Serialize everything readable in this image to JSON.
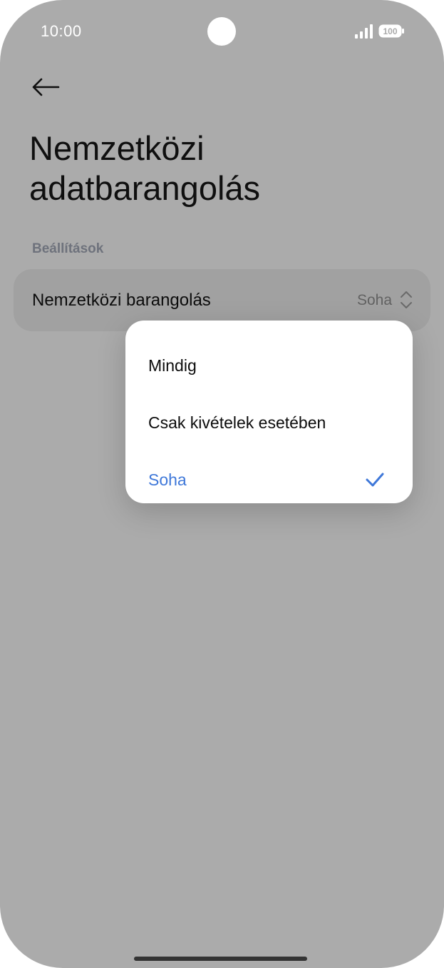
{
  "status_bar": {
    "time": "10:00",
    "battery_level": "100",
    "icons": [
      "signal-icon",
      "battery-icon"
    ]
  },
  "header": {
    "back_icon": "arrow-left-icon",
    "title_line1": "Nemzetközi",
    "title_line2": "adatbarangolás"
  },
  "section": {
    "label": "Beállítások"
  },
  "setting": {
    "label": "Nemzetközi barangolás",
    "value": "Soha",
    "icon": "chevron-up-down-icon"
  },
  "dropdown": {
    "options": [
      {
        "label": "Mindig",
        "selected": false
      },
      {
        "label": "Csak kivételek esetében",
        "selected": false
      },
      {
        "label": "Soha",
        "selected": true
      }
    ],
    "check_icon": "checkmark-icon"
  },
  "colors": {
    "accent": "#3f78d9",
    "scrim": "#ababab",
    "menu_bg": "#ffffff"
  }
}
